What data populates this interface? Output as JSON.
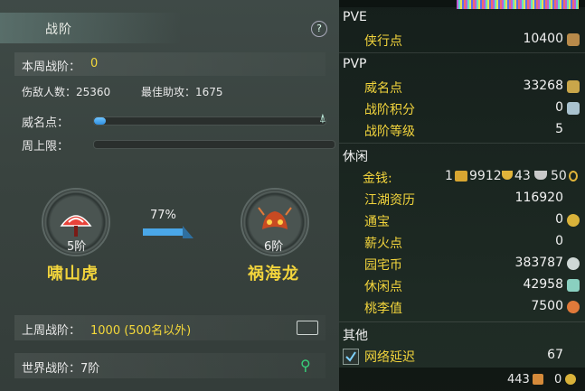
{
  "panel": {
    "title": "战阶",
    "help_icon": "?",
    "weekly_label": "本周战阶：",
    "weekly_value": "0",
    "kills_label": "伤敌人数：25360",
    "assist_label": "最佳助攻：1675",
    "fame_label": "威名点：",
    "fame_progress": 0.05,
    "weekly_cap_label": "周上限：",
    "weekly_cap_progress": 0,
    "current_rank": {
      "level": "5阶",
      "name": "啸山虎",
      "color": "#e8433a"
    },
    "progress_percent": "77%",
    "next_rank": {
      "level": "6阶",
      "name": "祸海龙",
      "color": "#d2582a"
    },
    "last_week_label": "上周战阶：",
    "last_week_value": "1000 (500名以外)",
    "world_label": "世界战阶：7阶"
  },
  "stats": {
    "pve_header": "PVE",
    "xiaxing_label": "侠行点",
    "xiaxing_value": "10400",
    "pvp_header": "PVP",
    "weiming_label": "威名点",
    "weiming_value": "33268",
    "zhanjie_jifen_label": "战阶积分",
    "zhanjie_jifen_value": "0",
    "zhanjie_dengji_label": "战阶等级",
    "zhanjie_dengji_value": "5",
    "leisure_header": "休闲",
    "money_label": "金钱:",
    "money_gold": "1",
    "money_silver": "9912",
    "money_copper1": "43",
    "money_copper2": "50",
    "jianghu_label": "江湖资历",
    "jianghu_value": "116920",
    "tongbao_label": "通宝",
    "tongbao_value": "0",
    "xinhuo_label": "薪火点",
    "xinhuo_value": "0",
    "yuanzhai_label": "园宅币",
    "yuanzhai_value": "383787",
    "xiuxian_label": "休闲点",
    "xiuxian_value": "42958",
    "taoli_label": "桃李值",
    "taoli_value": "7500",
    "other_header": "其他",
    "latency_label": "网络延迟",
    "latency_value": "67",
    "footer_left": "443",
    "footer_right": "0"
  }
}
